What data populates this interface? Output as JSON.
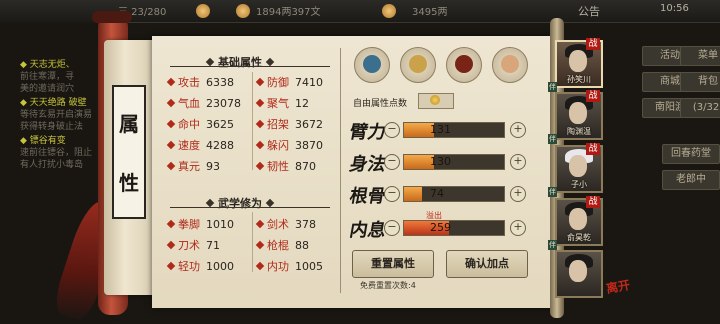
{
  "hud": {
    "topleft_text": "三 23/280",
    "money": "1894两397文",
    "fame": "3495两",
    "notice": "公告",
    "time": "10:56"
  },
  "quests": [
    {
      "title": "◆ 天志无炬、",
      "body": "前往寒潭，寻"
    },
    {
      "title": "",
      "body": "美的邀请润穴"
    },
    {
      "title": "◆ 天天绝路 破壁",
      "body": "等待玄易开启演易"
    },
    {
      "title": "",
      "body": "获得转身破止法"
    },
    {
      "title": "◆ 镖谷有变",
      "body": "速前往镖谷，阻止"
    },
    {
      "title": "",
      "body": "有人打扰小毒岛"
    }
  ],
  "right_menu": [
    "活动",
    "菜单",
    "商城",
    "背包",
    "南阳渡",
    "(3/32)",
    "回春药堂",
    "老郎中"
  ],
  "scroll": {
    "char1": "属",
    "char2": "性"
  },
  "basic": {
    "title": "基础属性",
    "stats": [
      {
        "label": "攻击",
        "value": "6338"
      },
      {
        "label": "防御",
        "value": "7410"
      },
      {
        "label": "气血",
        "value": "23078"
      },
      {
        "label": "聚气",
        "value": "12"
      },
      {
        "label": "命中",
        "value": "3625"
      },
      {
        "label": "招架",
        "value": "3672"
      },
      {
        "label": "速度",
        "value": "4288"
      },
      {
        "label": "躲闪",
        "value": "3870"
      },
      {
        "label": "真元",
        "value": "93"
      },
      {
        "label": "韧性",
        "value": "870"
      }
    ]
  },
  "martial": {
    "title": "武学修为",
    "stats": [
      {
        "label": "拳脚",
        "value": "1010"
      },
      {
        "label": "剑术",
        "value": "378"
      },
      {
        "label": "刀术",
        "value": "71"
      },
      {
        "label": "枪棍",
        "value": "88"
      },
      {
        "label": "轻功",
        "value": "1000"
      },
      {
        "label": "内功",
        "value": "1005"
      }
    ]
  },
  "free_points_label": "自由属性点数",
  "attributes": [
    {
      "name": "臂力",
      "value": "131",
      "fill": 0.3,
      "overflow": false
    },
    {
      "name": "身法",
      "value": "130",
      "fill": 0.3,
      "overflow": false
    },
    {
      "name": "根骨",
      "value": "74",
      "fill": 0.18,
      "overflow": false
    },
    {
      "name": "内息",
      "value": "259",
      "fill": 0.45,
      "overflow": true
    }
  ],
  "overflow_label": "溢出",
  "buttons": {
    "reset": "重置属性",
    "confirm": "确认加点"
  },
  "reset_note": "免费重置次数:4",
  "portraits": [
    {
      "name": "孙笑川",
      "selected": true,
      "badge": "战",
      "left": "伴"
    },
    {
      "name": "陶渊温",
      "selected": false,
      "badge": "战",
      "left": "伴"
    },
    {
      "name": "子小",
      "selected": false,
      "badge": "战",
      "left": "伴"
    },
    {
      "name": "俞昊乾",
      "selected": false,
      "badge": "战",
      "left": "伴"
    },
    {
      "name": "",
      "selected": false,
      "badge": "",
      "left": ""
    }
  ],
  "leave_label": "离开"
}
